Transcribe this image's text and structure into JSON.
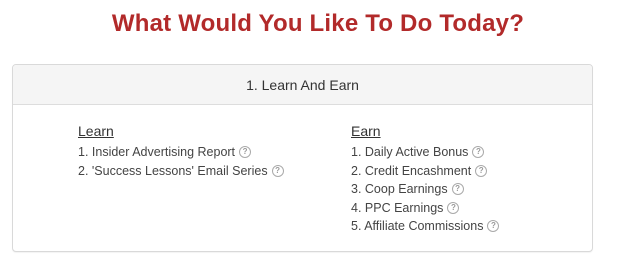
{
  "header": {
    "title": "What Would You Like To Do Today?"
  },
  "panel": {
    "heading": "1. Learn And Earn",
    "learn": {
      "title": "Learn",
      "items": [
        {
          "label": "1. Insider Advertising Report",
          "icon": "question-circle-icon",
          "icon_glyph": "?"
        },
        {
          "label": "2. 'Success Lessons' Email Series",
          "icon": "question-circle-icon",
          "icon_glyph": "?"
        }
      ]
    },
    "earn": {
      "title": "Earn",
      "items": [
        {
          "label": "1. Daily Active Bonus",
          "icon": "question-circle-icon",
          "icon_glyph": "?"
        },
        {
          "label": "2. Credit Encashment",
          "icon": "question-circle-icon",
          "icon_glyph": "?"
        },
        {
          "label": "3. Coop Earnings",
          "icon": "question-circle-icon",
          "icon_glyph": "?"
        },
        {
          "label": "4. PPC Earnings",
          "icon": "question-circle-icon",
          "icon_glyph": "?"
        },
        {
          "label": "5. Affiliate Commissions",
          "icon": "question-circle-icon",
          "icon_glyph": "?"
        }
      ]
    }
  },
  "colors": {
    "title": "#b22a2a",
    "panel_heading_bg": "#f5f5f5",
    "panel_border": "#d9d9d9",
    "text": "#333333"
  }
}
